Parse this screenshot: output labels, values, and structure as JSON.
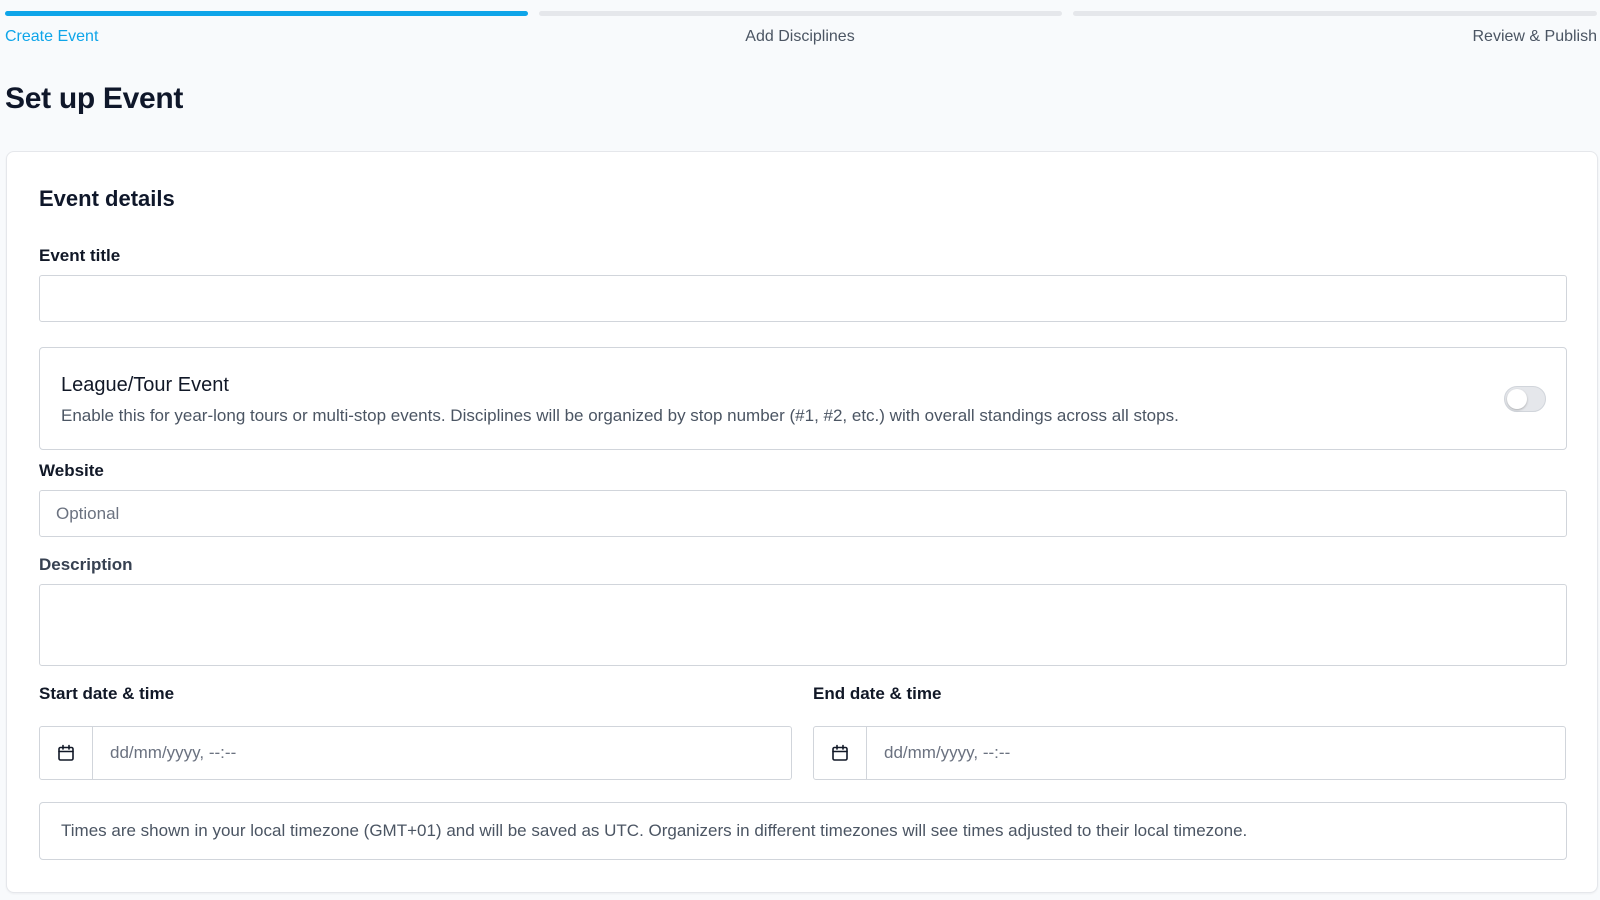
{
  "stepper": {
    "steps": [
      {
        "label": "Create Event",
        "state": "active"
      },
      {
        "label": "Add Disciplines",
        "state": "upcoming"
      },
      {
        "label": "Review & Publish",
        "state": "upcoming"
      }
    ]
  },
  "page": {
    "title": "Set up Event"
  },
  "event_details": {
    "heading": "Event details",
    "title_field": {
      "label": "Event title",
      "value": "",
      "placeholder": ""
    },
    "league": {
      "title": "League/Tour Event",
      "description": "Enable this for year-long tours or multi-stop events. Disciplines will be organized by stop number (#1, #2, etc.) with overall standings across all stops.",
      "enabled": false
    },
    "website_field": {
      "label": "Website",
      "value": "",
      "placeholder": "Optional"
    },
    "description_field": {
      "label": "Description",
      "value": ""
    },
    "start": {
      "label": "Start date & time",
      "placeholder": "dd/mm/yyyy, --:--",
      "icon": "calendar-icon"
    },
    "end": {
      "label": "End date & time",
      "placeholder": "dd/mm/yyyy, --:--",
      "icon": "calendar-icon"
    },
    "timezone_note": "Times are shown in your local timezone (GMT+01) and will be saved as UTC. Organizers in different timezones will see times adjusted to their local timezone."
  },
  "colors": {
    "accent": "#0ea5e9",
    "text": "#0f172a",
    "muted": "#4b5563",
    "border": "#d1d5db"
  }
}
